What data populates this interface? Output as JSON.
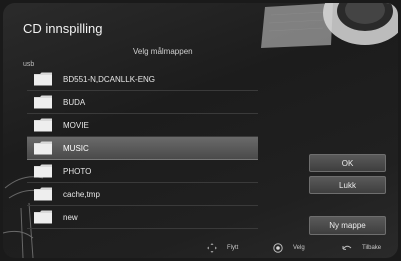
{
  "dialog": {
    "title": "CD innspilling",
    "subtitle": "Velg målmappen",
    "path": "usb"
  },
  "folders": [
    {
      "label": "BD551-N,DCANLLK-ENG",
      "selected": false
    },
    {
      "label": "BUDA",
      "selected": false
    },
    {
      "label": "MOVIE",
      "selected": false
    },
    {
      "label": "MUSIC",
      "selected": true
    },
    {
      "label": "PHOTO",
      "selected": false
    },
    {
      "label": "cache,tmp",
      "selected": false
    },
    {
      "label": "new",
      "selected": false
    }
  ],
  "buttons": {
    "ok": "OK",
    "close": "Lukk",
    "new_folder": "Ny mappe"
  },
  "hints": {
    "move": "Flytt",
    "select": "Velg",
    "back": "Tilbake"
  },
  "colors": {
    "folder_icon": "#d9d9d9",
    "selected_row": "#5a5a5a"
  }
}
